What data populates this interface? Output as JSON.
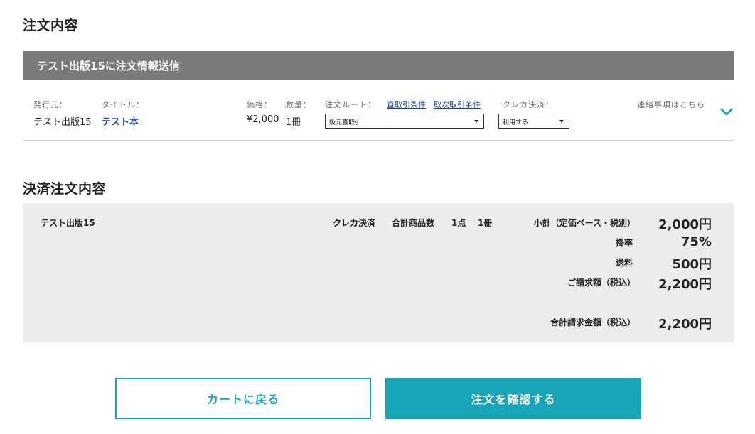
{
  "order_section": {
    "heading": "注文内容",
    "banner_title": "テスト出版15に注文情報送信",
    "labels": {
      "publisher": "発行元：",
      "title": "タイトル：",
      "price": "価格：",
      "quantity": "数量：",
      "route": "注文ルート：",
      "direct_terms_link": "直取引条件",
      "agency_terms_link": "取次取引条件",
      "card_payment": "クレカ決済：",
      "contact": "連絡事項はこちら"
    },
    "item": {
      "publisher": "テスト出版15",
      "title": "テスト本",
      "price": "¥2,000",
      "quantity": "1冊",
      "route_selected": "販元直取引",
      "card_selected": "利用する"
    },
    "expand_icon": "chevron-down-icon"
  },
  "payment_section": {
    "heading": "決済注文内容",
    "publisher": "テスト出版15",
    "payment_method": "クレカ決済",
    "total_items_label": "合計商品数",
    "total_points": "1点",
    "total_volumes": "1冊",
    "summary": [
      {
        "label": "小計（定価ベース・税別）",
        "value": "2,000円"
      },
      {
        "label": "掛率",
        "value": "75%"
      },
      {
        "label": "送料",
        "value": "500円"
      },
      {
        "label": "ご請求額（税込）",
        "value": "2,200円"
      }
    ],
    "grand_total": {
      "label": "合計請求金額（税込）",
      "value": "2,200円"
    }
  },
  "buttons": {
    "back_to_cart": "カートに戻る",
    "confirm_order": "注文を確認する"
  },
  "colors": {
    "accent": "#18a5b8",
    "banner": "#7a7a7a",
    "panel": "#ececec",
    "link": "#1a4a9a"
  }
}
